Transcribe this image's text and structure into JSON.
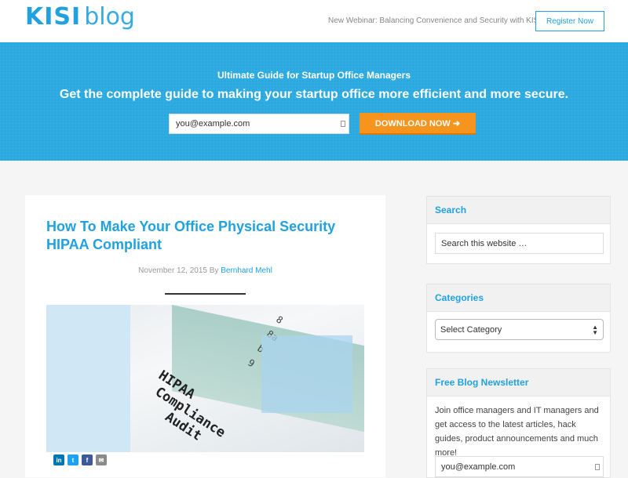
{
  "header": {
    "logo_primary": "KISI",
    "logo_secondary": "blog",
    "webinar_text": "New Webinar: Balancing Convenience and Security with KISI",
    "register_label": "Register Now"
  },
  "hero": {
    "subtitle": "Ultimate Guide for Startup Office Managers",
    "title": "Get the complete guide to making your startup office more efficient and more secure.",
    "email_value": "you@example.com",
    "download_label": "DOWNLOAD NOW ➜"
  },
  "article": {
    "title": "How To Make Your Office Physical Security HIPAA Compliant",
    "date": "November 12, 2015",
    "by": "By",
    "author": "Bernhard Mehl",
    "image_lines": [
      "HIPAA",
      "Compliance",
      "Audit"
    ],
    "image_form": [
      "8",
      "8a",
      "b",
      "9"
    ],
    "social": [
      {
        "icon": "linkedin-icon",
        "glyph": "in",
        "color": "#0077b5"
      },
      {
        "icon": "twitter-icon",
        "glyph": "t",
        "color": "#1da1f2"
      },
      {
        "icon": "facebook-icon",
        "glyph": "f",
        "color": "#3b5998"
      },
      {
        "icon": "email-icon",
        "glyph": "✉",
        "color": "#8a8a8a"
      }
    ]
  },
  "sidebar": {
    "search": {
      "heading": "Search",
      "placeholder": "Search this website …"
    },
    "categories": {
      "heading": "Categories",
      "selected": "Select Category"
    },
    "newsletter": {
      "heading": "Free Blog Newsletter",
      "body": "Join office managers and IT managers and get access to the latest articles, hack guides, product announcements and much more!",
      "email_value": "you@example.com"
    }
  },
  "colors": {
    "accent": "#21a1de",
    "hero_bg": "#2aa9e0",
    "cta": "#f7941d"
  }
}
